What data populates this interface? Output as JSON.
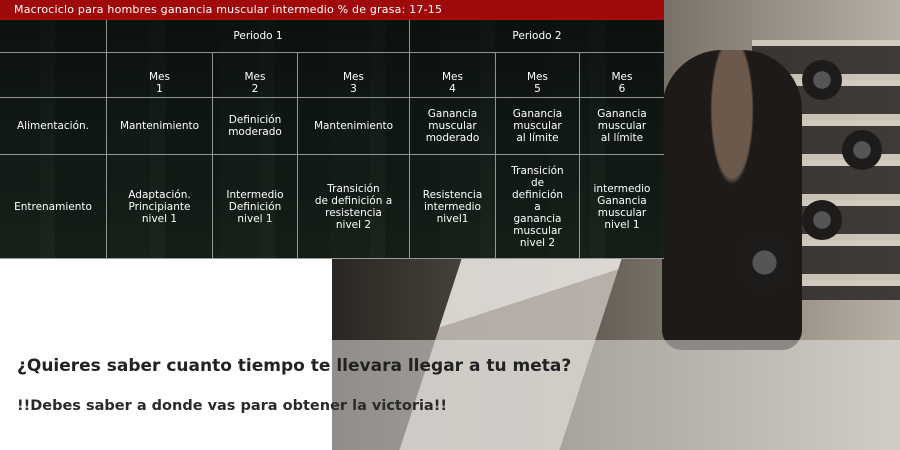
{
  "title": "Macrociclo para hombres ganancia muscular intermedio % de grasa: 17-15",
  "table": {
    "periods": [
      "Periodo 1",
      "Periodo 2"
    ],
    "months": [
      "Mes\n1",
      "Mes\n2",
      "Mes\n3",
      "Mes\n4",
      "Mes\n5",
      "Mes\n6"
    ],
    "rows": [
      {
        "label": "Alimentación.",
        "cells": [
          "Mantenimiento",
          "Definición\nmoderado",
          "Mantenimiento",
          "Ganancia\nmuscular\nmoderado",
          "Ganancia\nmuscular\nal límite",
          "Ganancia\nmuscular\nal límite"
        ]
      },
      {
        "label": "Entrenamiento",
        "cells": [
          "Adaptación.\nPrincipiante\nnivel 1",
          "Intermedio\nDefinición\nnivel 1",
          "Transición\nde definición a\nresistencia\nnivel 2",
          "Resistencia\nintermedio\nnivel1",
          "Transición\nde\ndefinición\na\nganancia\nmuscular\nnivel 2",
          "intermedio\nGanancia\nmuscular\nnivel 1"
        ]
      }
    ]
  },
  "question": "¿Quieres saber cuanto tiempo te llevara llegar a tu meta?",
  "slogan": "!!Debes saber a donde vas para obtener la victoria!!",
  "colors": {
    "title_bar": "#a10a0a",
    "panel": "#0e1612"
  }
}
